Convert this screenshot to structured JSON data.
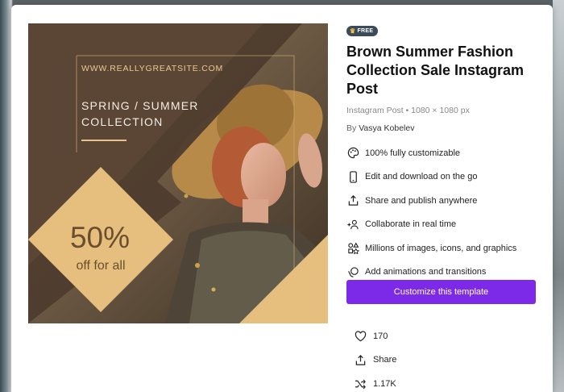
{
  "template": {
    "site_url": "WWW.REALLYGREATSITE.COM",
    "headline": "SPRING / SUMMER\nCOLLECTION",
    "discount_value": "50%",
    "discount_label": "off for all"
  },
  "details": {
    "badge": "FREE",
    "title": "Brown Summer Fashion Collection Sale Instagram Post",
    "meta": "Instagram Post • 1080 × 1080 px",
    "author_prefix": "By",
    "author_name": "Vasya Kobelev",
    "features": [
      {
        "icon": "palette-icon",
        "label": "100% fully customizable"
      },
      {
        "icon": "phone-icon",
        "label": "Edit and download on the go"
      },
      {
        "icon": "share-upload-icon",
        "label": "Share and publish anywhere"
      },
      {
        "icon": "collaborate-icon",
        "label": "Collaborate in real time"
      },
      {
        "icon": "elements-icon",
        "label": "Millions of images, icons, and graphics"
      },
      {
        "icon": "animation-icon",
        "label": "Add animations and transitions"
      }
    ],
    "cta_label": "Customize this template"
  },
  "stats": {
    "likes": "170",
    "share_label": "Share",
    "remix_count": "1.17K"
  },
  "colors": {
    "accent": "#7d2ae8",
    "badge_bg": "#3c4a5a",
    "template_brown": "#5a4a3c",
    "template_tan": "#e6bf7e"
  }
}
